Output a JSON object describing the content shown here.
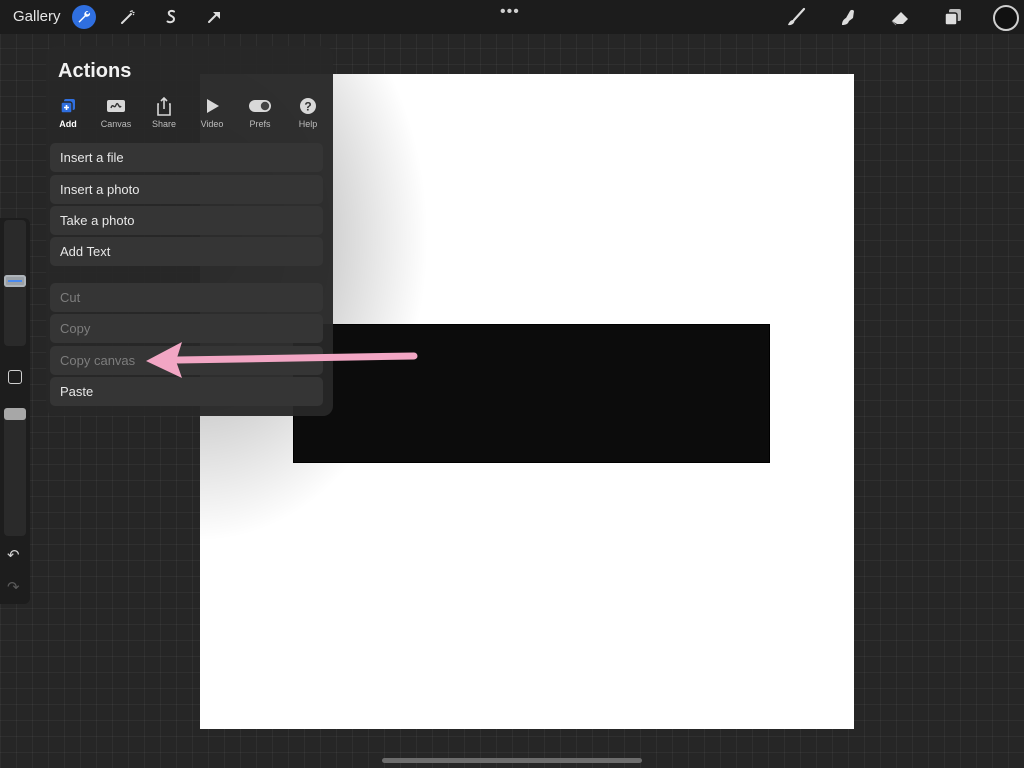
{
  "topbar": {
    "gallery": "Gallery",
    "more": "•••",
    "left_tools": [
      "wrench-icon",
      "magic-wand-icon",
      "selection-icon",
      "transform-arrow-icon"
    ],
    "right_tools": [
      "brush-icon",
      "smudge-icon",
      "eraser-icon",
      "layers-icon"
    ],
    "active_color": "#111111"
  },
  "actions": {
    "title": "Actions",
    "tabs": [
      {
        "label": "Add"
      },
      {
        "label": "Canvas"
      },
      {
        "label": "Share"
      },
      {
        "label": "Video"
      },
      {
        "label": "Prefs"
      },
      {
        "label": "Help"
      }
    ],
    "active_tab": "Add",
    "group1": [
      {
        "label": "Insert a file"
      },
      {
        "label": "Insert a photo"
      },
      {
        "label": "Take a photo"
      },
      {
        "label": "Add Text"
      }
    ],
    "group2": [
      {
        "label": "Cut",
        "enabled": false
      },
      {
        "label": "Copy",
        "enabled": false
      },
      {
        "label": "Copy canvas",
        "enabled": false
      },
      {
        "label": "Paste",
        "enabled": true
      }
    ]
  },
  "annotation": {
    "color": "#f2a6c4",
    "points_to": "Copy canvas"
  },
  "accent_color": "#2f6fe0"
}
